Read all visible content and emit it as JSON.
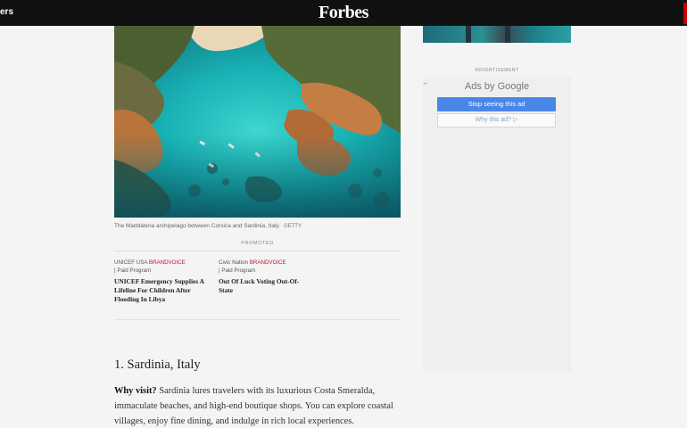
{
  "header": {
    "left_fragment": "ers",
    "logo": "Forbes"
  },
  "article": {
    "image_caption": "The Maddalena archipelago between Corsica and Sardinia, Italy.",
    "image_credit": "GETTY",
    "promoted_label": "PROMOTED",
    "promoted_items": [
      {
        "source": "UNICEF USA",
        "brand": "BRANDVOICE",
        "paid": "| Paid Program",
        "title": "UNICEF Emergency Supplies A Lifeline For Children After Flooding In Libya"
      },
      {
        "source": "Civic Nation",
        "brand": "BRANDVOICE",
        "paid": "| Paid Program",
        "title": "Out Of Luck Voting Out-Of-State"
      }
    ],
    "section_title": "1. Sardinia, Italy",
    "lead_label": "Why visit?",
    "lead_body": " Sardinia lures travelers with its luxurious Costa Smeralda, immaculate beaches, and high-end boutique shops. You can explore coastal villages, enjoy fine dining, and indulge in rich local experiences."
  },
  "sidebar_ad": {
    "label": "ADVERTISEMENT",
    "back_icon": "arrow-left-icon",
    "ads_by_prefix": "Ads by ",
    "ads_by_brand": "Google",
    "stop_button": "Stop seeing this ad",
    "why_button": "Why this ad? ▷"
  },
  "colors": {
    "topbar": "#111111",
    "brandvoice": "#c8102e",
    "stop_button": "#4a86e8"
  }
}
